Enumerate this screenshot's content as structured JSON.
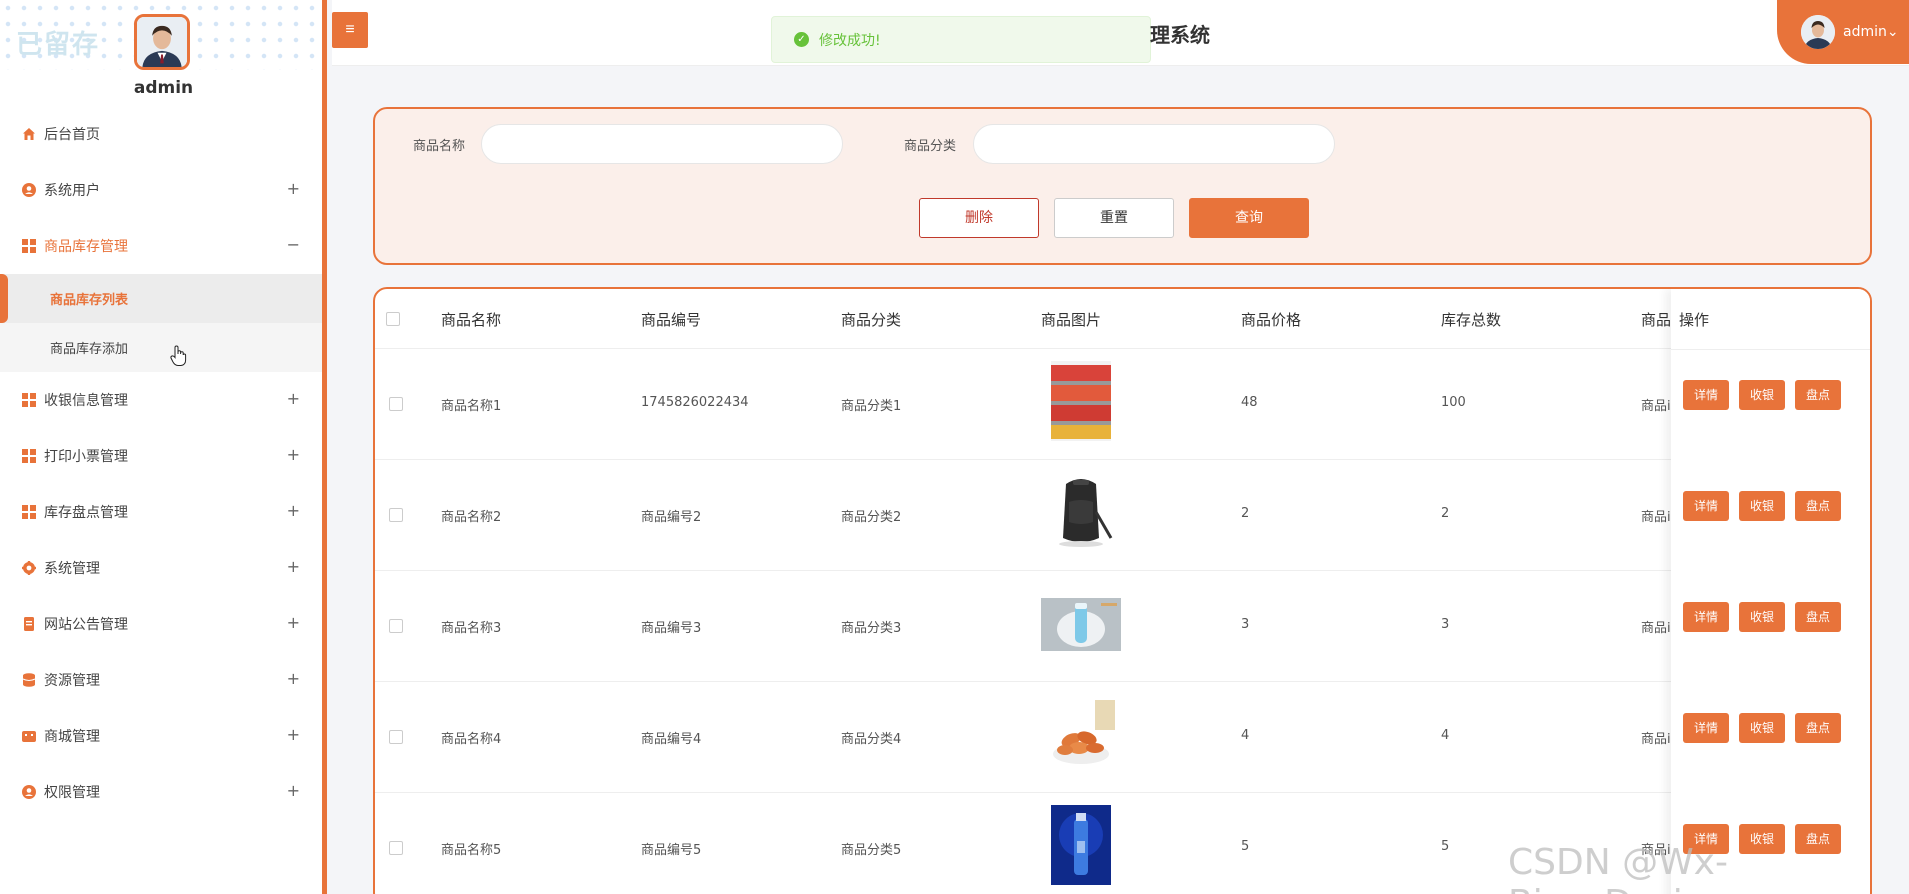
{
  "sidebar": {
    "logo_text": "已留存",
    "username": "admin",
    "items": [
      {
        "label": "后台首页"
      },
      {
        "label": "系统用户",
        "toggle": "+"
      },
      {
        "label": "商品库存管理",
        "toggle": "−"
      },
      {
        "label": "收银信息管理",
        "toggle": "+"
      },
      {
        "label": "打印小票管理",
        "toggle": "+"
      },
      {
        "label": "库存盘点管理",
        "toggle": "+"
      },
      {
        "label": "系统管理",
        "toggle": "+"
      },
      {
        "label": "网站公告管理",
        "toggle": "+"
      },
      {
        "label": "资源管理",
        "toggle": "+"
      },
      {
        "label": "商城管理",
        "toggle": "+"
      },
      {
        "label": "权限管理",
        "toggle": "+"
      }
    ],
    "subitems": [
      {
        "label": "商品库存列表"
      },
      {
        "label": "商品库存添加"
      }
    ]
  },
  "header": {
    "toggle_icon": "≡",
    "title": "理系统",
    "user": "admin",
    "user_caret": "⌄"
  },
  "toast": {
    "message": "修改成功!",
    "icon": "✓"
  },
  "search": {
    "name_label": "商品名称",
    "category_label": "商品分类",
    "name_value": "",
    "category_value": "",
    "delete_label": "删除",
    "reset_label": "重置",
    "query_label": "查询"
  },
  "table": {
    "headers": [
      "商品名称",
      "商品编号",
      "商品分类",
      "商品图片",
      "商品价格",
      "库存总数",
      "商品",
      "操作"
    ],
    "rows": [
      {
        "name": "商品名称1",
        "code": "1745826022434",
        "category": "商品分类1",
        "price": "48",
        "stock": "100",
        "extra": "商品i",
        "image": "drinks-shelf"
      },
      {
        "name": "商品名称2",
        "code": "商品编号2",
        "category": "商品分类2",
        "price": "2",
        "stock": "2",
        "extra": "商品i",
        "image": "backpack"
      },
      {
        "name": "商品名称3",
        "code": "商品编号3",
        "category": "商品分类3",
        "price": "3",
        "stock": "3",
        "extra": "商品i",
        "image": "bottle-on-plate"
      },
      {
        "name": "商品名称4",
        "code": "商品编号4",
        "category": "商品分类4",
        "price": "4",
        "stock": "4",
        "extra": "商品i",
        "image": "snacks-bowl"
      },
      {
        "name": "商品名称5",
        "code": "商品编号5",
        "category": "商品分类5",
        "price": "5",
        "stock": "5",
        "extra": "商品i",
        "image": "blue-bottle"
      }
    ],
    "ops": {
      "detail": "详情",
      "checkout": "收银",
      "inventory": "盘点"
    }
  },
  "watermark": "CSDN @Wx-Biye_Design",
  "colors": {
    "accent": "#e8733a",
    "success": "#67c23a",
    "danger": "#c0392b"
  }
}
